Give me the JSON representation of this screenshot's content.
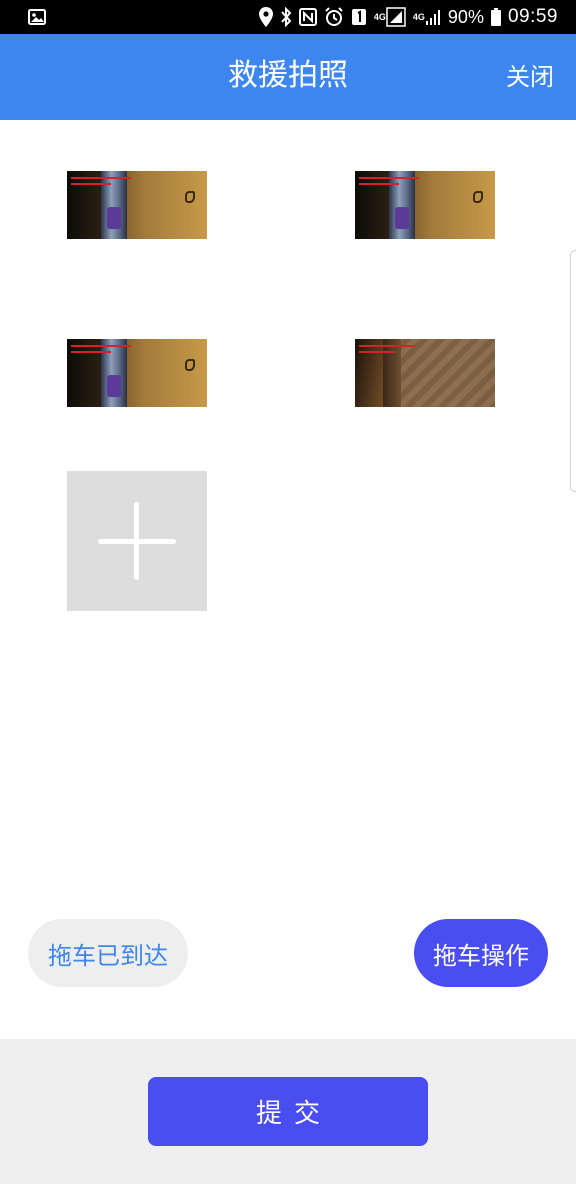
{
  "status_bar": {
    "left_icon": "image-notification-icon",
    "icons": [
      "location-pin-icon",
      "bluetooth-icon",
      "nfc-icon",
      "alarm-icon",
      "sim-1-icon"
    ],
    "network_1": "4G",
    "network_2": "4G",
    "battery_percent": "90%",
    "time": "09:59"
  },
  "header": {
    "title": "救援拍照",
    "close_label": "关闭",
    "color": "#3D86F0"
  },
  "photos": {
    "items": [
      {
        "icon": "photo-thumbnail"
      },
      {
        "icon": "photo-thumbnail"
      },
      {
        "icon": "photo-thumbnail"
      },
      {
        "icon": "photo-thumbnail"
      }
    ],
    "add_icon": "plus-icon"
  },
  "actions": {
    "tow_arrived_label": "拖车已到达",
    "tow_operate_label": "拖车操作",
    "accent": "#4A4DF2"
  },
  "footer": {
    "submit_label": "提交"
  }
}
